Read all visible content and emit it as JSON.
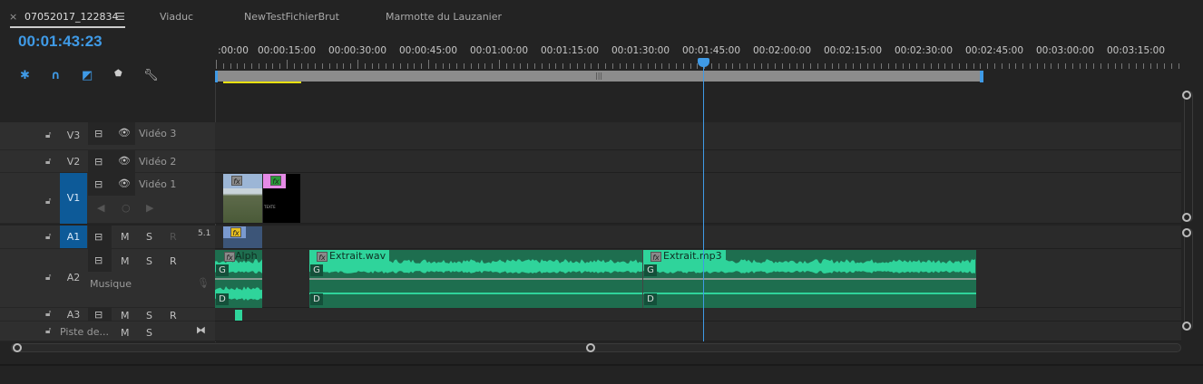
{
  "tabs": [
    {
      "label": "07052017_122834",
      "active": true
    },
    {
      "label": "Viaduc"
    },
    {
      "label": "NewTestFichierBrut"
    },
    {
      "label": "Marmotte du Lauzanier"
    }
  ],
  "tab_close": "×",
  "tab_menu": "☰",
  "timecode": "00:01:43:23",
  "tools": [
    "snap-icon",
    "magnet-icon",
    "linked-selection-icon",
    "marker-icon",
    "wrench-icon"
  ],
  "ruler": [
    ":00:00",
    "00:00:15:00",
    "00:00:30:00",
    "00:00:45:00",
    "00:01:00:00",
    "00:01:15:00",
    "00:01:30:00",
    "00:01:45:00",
    "00:02:00:00",
    "00:02:15:00",
    "00:02:30:00",
    "00:02:45:00",
    "00:03:00:00",
    "00:03:15:00"
  ],
  "tracks": {
    "v3": {
      "id": "V3",
      "name": "Vidéo 3"
    },
    "v2": {
      "id": "V2",
      "name": "Vidéo 2"
    },
    "v1": {
      "id": "V1",
      "name": "Vidéo 1"
    },
    "a1": {
      "id": "A1",
      "m": "M",
      "s": "S",
      "r": "R",
      "channel": "5.1"
    },
    "a2": {
      "id": "A2",
      "m": "M",
      "s": "S",
      "r": "R",
      "name": "Musique"
    },
    "a3": {
      "id": "A3",
      "m": "M",
      "s": "S",
      "r": "R"
    },
    "master": {
      "name": "Piste de...",
      "m": "M",
      "s": "S"
    }
  },
  "clips": {
    "fx": "fx",
    "alph": "Alph",
    "wav": "Extrait.wav",
    "mp3": "Extrait.mp3",
    "g": "G",
    "d": "D",
    "title_card": "TEXTE"
  },
  "colors": {
    "accent": "#3f9ae6",
    "audio": "#2fd49b",
    "audio_dark": "#1e6e4f",
    "selected": "#0d5a98",
    "work_area": "#e8e010"
  }
}
